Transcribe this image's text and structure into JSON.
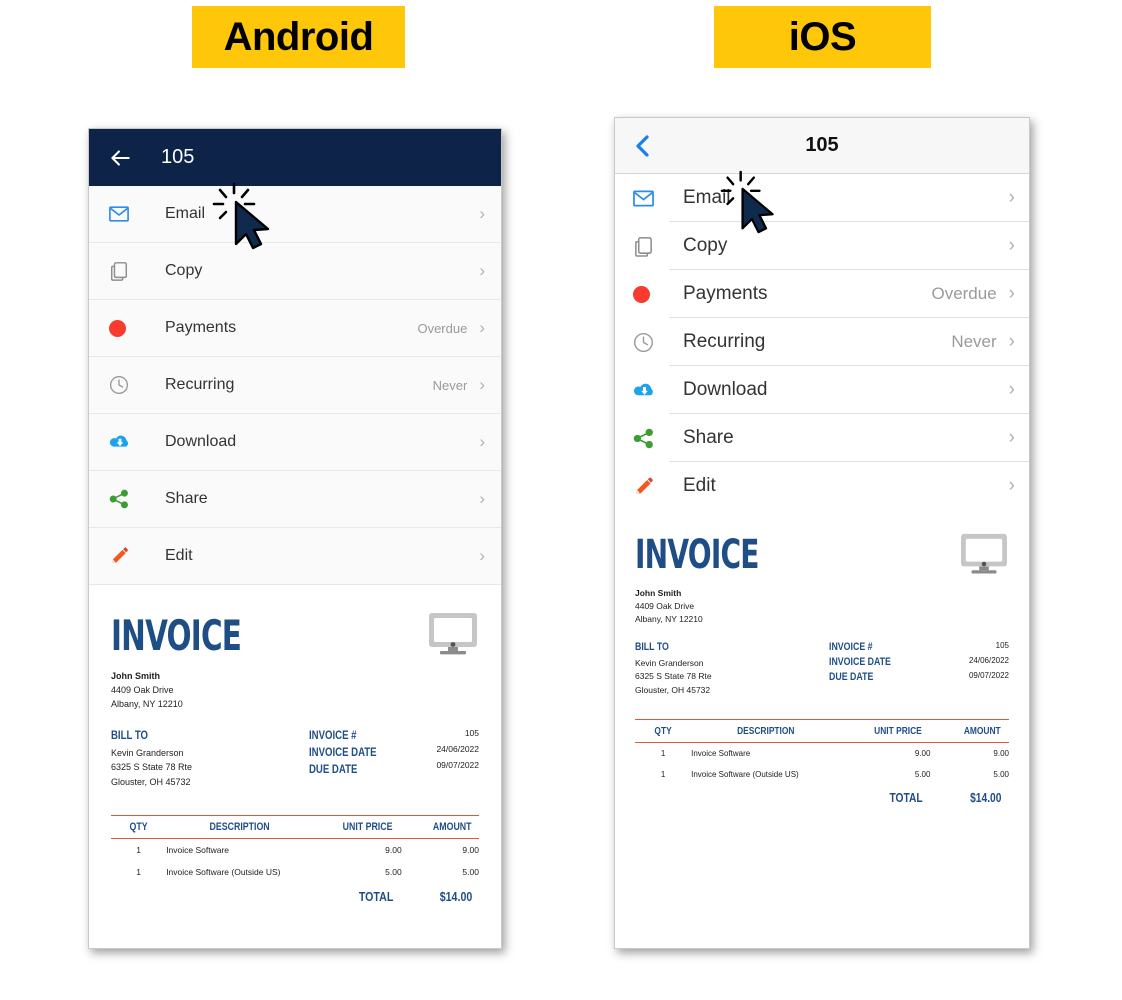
{
  "badges": {
    "android": "Android",
    "ios": "iOS",
    "accent_bg": "#ffc709"
  },
  "colors": {
    "android_appbar": "#0d2348",
    "ios_appbar": "#f7f7f7",
    "invoice_blue": "#1f4e87",
    "table_rule": "#e7543c",
    "status_red": "#f73b2f",
    "email_blue": "#2d8ceb",
    "cloud_blue": "#1ca3e8",
    "share_green": "#3f9c35",
    "edit_orange": "#f4581f",
    "ios_back_blue": "#1a7df0"
  },
  "android": {
    "appbar": {
      "back_icon": "arrow-left-icon",
      "title": "105"
    },
    "rows": [
      {
        "icon": "email-icon",
        "label": "Email",
        "value": "",
        "chevron": "›"
      },
      {
        "icon": "copy-icon",
        "label": "Copy",
        "value": "",
        "chevron": "›"
      },
      {
        "icon": "payments-icon",
        "label": "Payments",
        "value": "Overdue",
        "chevron": "›"
      },
      {
        "icon": "recurring-icon",
        "label": "Recurring",
        "value": "Never",
        "chevron": "›"
      },
      {
        "icon": "download-icon",
        "label": "Download",
        "value": "",
        "chevron": "›"
      },
      {
        "icon": "share-icon",
        "label": "Share",
        "value": "",
        "chevron": "›"
      },
      {
        "icon": "edit-icon",
        "label": "Edit",
        "value": "",
        "chevron": "›"
      }
    ]
  },
  "ios": {
    "appbar": {
      "back_icon": "chevron-left-icon",
      "title": "105"
    },
    "rows": [
      {
        "icon": "email-icon",
        "label": "Email",
        "value": "",
        "chevron": "›"
      },
      {
        "icon": "copy-icon",
        "label": "Copy",
        "value": "",
        "chevron": "›"
      },
      {
        "icon": "payments-icon",
        "label": "Payments",
        "value": "Overdue",
        "chevron": "›"
      },
      {
        "icon": "recurring-icon",
        "label": "Recurring",
        "value": "Never",
        "chevron": "›"
      },
      {
        "icon": "download-icon",
        "label": "Download",
        "value": "",
        "chevron": "›"
      },
      {
        "icon": "share-icon",
        "label": "Share",
        "value": "",
        "chevron": "›"
      },
      {
        "icon": "edit-icon",
        "label": "Edit",
        "value": "",
        "chevron": "›"
      }
    ]
  },
  "invoice": {
    "title": "INVOICE",
    "logo_icon": "monitor-icon",
    "sender": {
      "name": "John Smith",
      "street": "4409 Oak Drive",
      "city": "Albany, NY 12210"
    },
    "bill_to_label": "BILL TO",
    "bill_to": {
      "name": "Kevin Granderson",
      "street": "6325 S State 78 Rte",
      "city": "Glouster, OH 45732"
    },
    "meta": [
      {
        "key": "INVOICE #",
        "value": "105"
      },
      {
        "key": "INVOICE DATE",
        "value": "24/06/2022"
      },
      {
        "key": "DUE DATE",
        "value": "09/07/2022"
      }
    ],
    "table": {
      "headers": [
        "QTY",
        "DESCRIPTION",
        "UNIT PRICE",
        "AMOUNT"
      ],
      "rows": [
        {
          "qty": "1",
          "description": "Invoice Software",
          "unit_price": "9.00",
          "amount": "9.00"
        },
        {
          "qty": "1",
          "description": "Invoice Software (Outside US)",
          "unit_price": "5.00",
          "amount": "5.00"
        }
      ],
      "total_label": "TOTAL",
      "total_value": "$14.00"
    }
  },
  "cursor": {
    "name": "click-cursor",
    "state": "clicking"
  }
}
